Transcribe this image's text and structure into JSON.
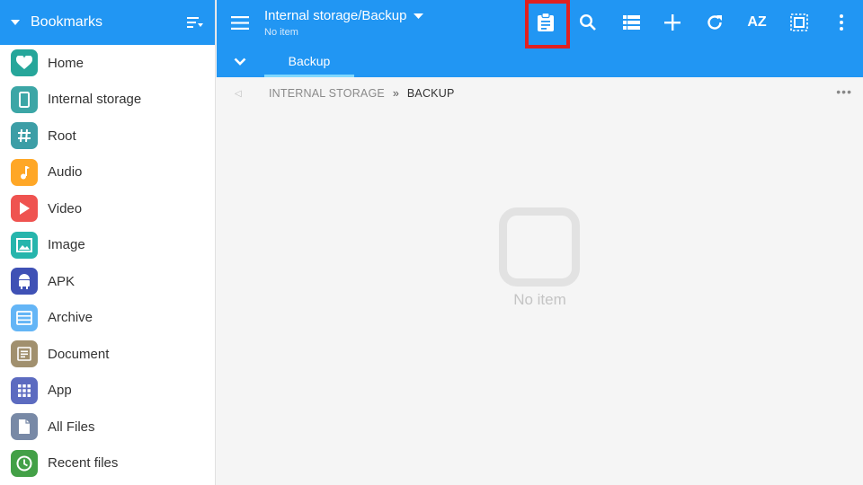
{
  "sidebar": {
    "title": "Bookmarks",
    "items": [
      {
        "label": "Home",
        "icon": "heart-icon",
        "color": "#26a69a"
      },
      {
        "label": "Internal storage",
        "icon": "phone-icon",
        "color": "#3ca6a6"
      },
      {
        "label": "Root",
        "icon": "hash-icon",
        "color": "#3c9ea6"
      },
      {
        "label": "Audio",
        "icon": "music-note-icon",
        "color": "#ffa726"
      },
      {
        "label": "Video",
        "icon": "play-icon",
        "color": "#ef5350"
      },
      {
        "label": "Image",
        "icon": "image-icon",
        "color": "#26b5ac"
      },
      {
        "label": "APK",
        "icon": "android-icon",
        "color": "#3f51b5"
      },
      {
        "label": "Archive",
        "icon": "archive-icon",
        "color": "#64b5f6"
      },
      {
        "label": "Document",
        "icon": "document-icon",
        "color": "#a1906e"
      },
      {
        "label": "App",
        "icon": "grid-icon",
        "color": "#5c6bc0"
      },
      {
        "label": "All Files",
        "icon": "file-icon",
        "color": "#7889a6"
      },
      {
        "label": "Recent files",
        "icon": "clock-icon",
        "color": "#43a047"
      }
    ]
  },
  "header": {
    "title": "Internal storage/Backup",
    "subtitle": "No item",
    "accent": "#2196f3",
    "sort_label": "AZ",
    "highlight_color": "#e02020"
  },
  "tabs": [
    {
      "label": "Backup",
      "active": true
    }
  ],
  "breadcrumb": {
    "items": [
      "INTERNAL STORAGE",
      "BACKUP"
    ],
    "separator": "»"
  },
  "empty_state": {
    "text": "No item"
  }
}
